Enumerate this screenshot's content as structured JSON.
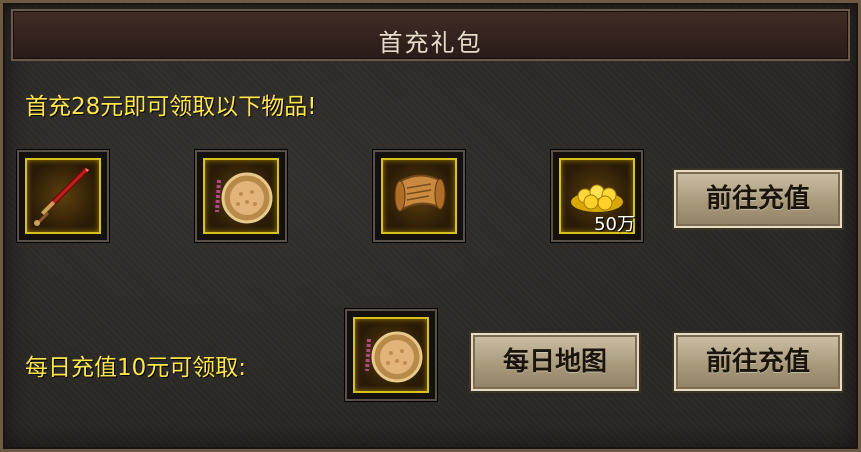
{
  "title": "首充礼包",
  "first_recharge": {
    "text": "首充28元即可领取以下物品!",
    "items": [
      {
        "icon": "red-sword-icon"
      },
      {
        "icon": "round-shield-icon"
      },
      {
        "icon": "scroll-icon"
      },
      {
        "icon": "gold-coins-icon",
        "quantity": "50万"
      }
    ],
    "button_label": "前往充值"
  },
  "daily_recharge": {
    "text": "每日充值10元可领取:",
    "items": [
      {
        "icon": "round-shield-icon"
      }
    ],
    "map_button_label": "每日地图",
    "button_label": "前往充值"
  },
  "colors": {
    "accent_text": "#ffe64a",
    "slot_border": "#d6c21b"
  }
}
